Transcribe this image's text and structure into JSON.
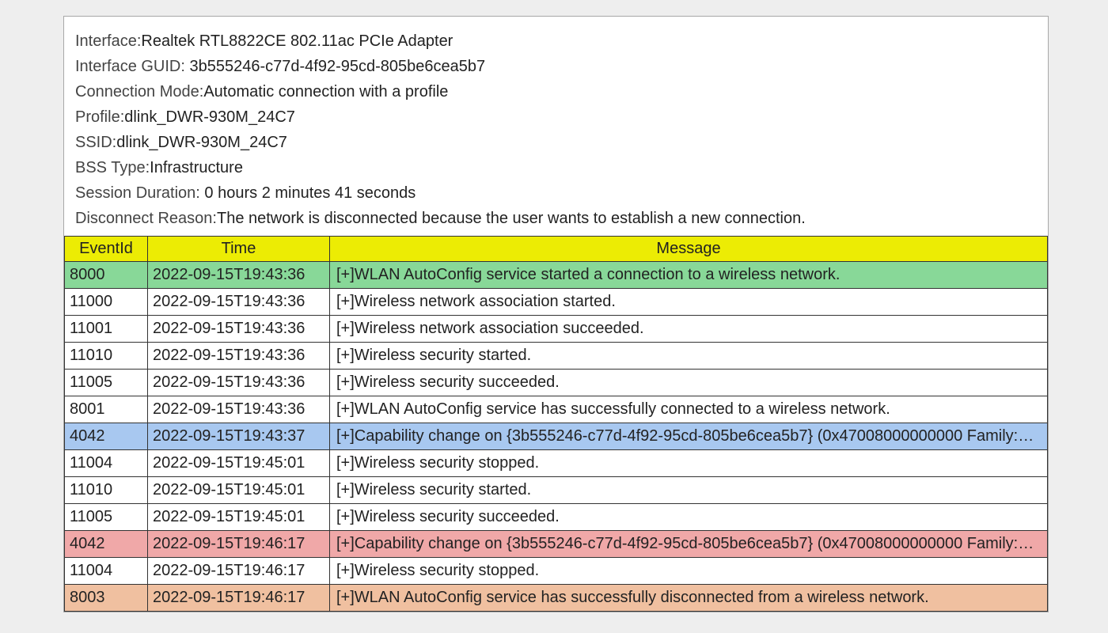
{
  "meta": {
    "interface_label": "Interface:",
    "interface_value": "Realtek RTL8822CE 802.11ac PCIe Adapter",
    "guid_label": "Interface GUID: ",
    "guid_value": "3b555246-c77d-4f92-95cd-805be6cea5b7",
    "mode_label": "Connection Mode:",
    "mode_value": "Automatic connection with a profile",
    "profile_label": "Profile:",
    "profile_value": "dlink_DWR-930M_24C7",
    "ssid_label": "SSID:",
    "ssid_value": "dlink_DWR-930M_24C7",
    "bss_label": "BSS Type:",
    "bss_value": "Infrastructure",
    "duration_label": "Session Duration: ",
    "duration_value": "0 hours 2 minutes 41 seconds",
    "reason_label": "Disconnect Reason:",
    "reason_value": "The network is disconnected because the user wants to establish a new connection."
  },
  "columns": {
    "event": "EventId",
    "time": "Time",
    "message": "Message"
  },
  "events": [
    {
      "id": "8000",
      "time": "2022-09-15T19:43:36",
      "msg": "[+]WLAN AutoConfig service started a connection to a wireless network.",
      "color": "green"
    },
    {
      "id": "11000",
      "time": "2022-09-15T19:43:36",
      "msg": "[+]Wireless network association started.",
      "color": "white"
    },
    {
      "id": "11001",
      "time": "2022-09-15T19:43:36",
      "msg": "[+]Wireless network association succeeded.",
      "color": "white"
    },
    {
      "id": "11010",
      "time": "2022-09-15T19:43:36",
      "msg": "[+]Wireless security started.",
      "color": "white"
    },
    {
      "id": "11005",
      "time": "2022-09-15T19:43:36",
      "msg": "[+]Wireless security succeeded.",
      "color": "white"
    },
    {
      "id": "8001",
      "time": "2022-09-15T19:43:36",
      "msg": "[+]WLAN AutoConfig service has successfully connected to a wireless network.",
      "color": "white"
    },
    {
      "id": "4042",
      "time": "2022-09-15T19:43:37",
      "msg": "[+]Capability change on {3b555246-c77d-4f92-95cd-805be6cea5b7} (0x47008000000000 Family:…",
      "color": "blue"
    },
    {
      "id": "11004",
      "time": "2022-09-15T19:45:01",
      "msg": "[+]Wireless security stopped.",
      "color": "white"
    },
    {
      "id": "11010",
      "time": "2022-09-15T19:45:01",
      "msg": "[+]Wireless security started.",
      "color": "white"
    },
    {
      "id": "11005",
      "time": "2022-09-15T19:45:01",
      "msg": "[+]Wireless security succeeded.",
      "color": "white"
    },
    {
      "id": "4042",
      "time": "2022-09-15T19:46:17",
      "msg": "[+]Capability change on {3b555246-c77d-4f92-95cd-805be6cea5b7} (0x47008000000000 Family:…",
      "color": "red"
    },
    {
      "id": "11004",
      "time": "2022-09-15T19:46:17",
      "msg": "[+]Wireless security stopped.",
      "color": "white"
    },
    {
      "id": "8003",
      "time": "2022-09-15T19:46:17",
      "msg": "[+]WLAN AutoConfig service has successfully disconnected from a wireless network.",
      "color": "orange"
    }
  ]
}
